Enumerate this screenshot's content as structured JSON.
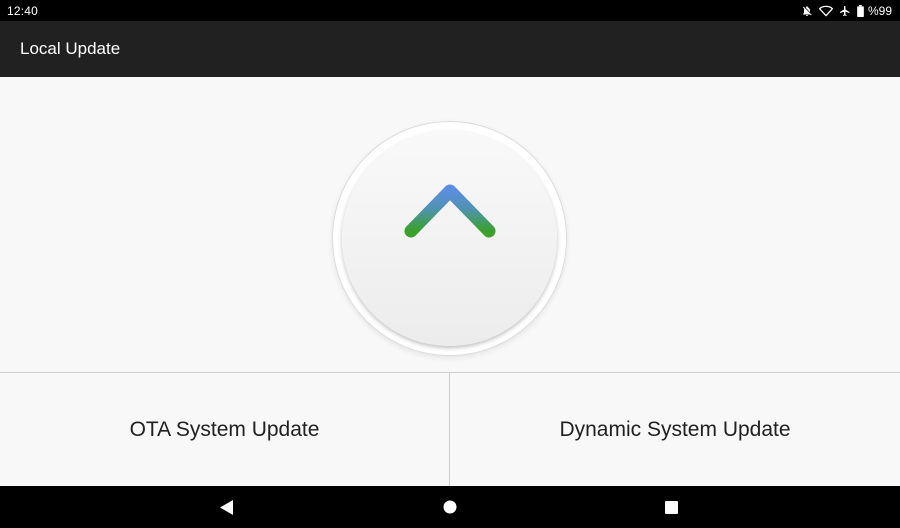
{
  "status_bar": {
    "time": "12:40",
    "battery_text": "%99",
    "icons": [
      "notifications-off-icon",
      "wifi-icon",
      "airplane-icon",
      "battery-icon"
    ]
  },
  "app_bar": {
    "title": "Local Update"
  },
  "main": {
    "upload_icon": "arrow-up-icon",
    "options": [
      {
        "label": "OTA System Update"
      },
      {
        "label": "Dynamic System Update"
      }
    ]
  },
  "nav_bar": {
    "icons": [
      "back-icon",
      "home-icon",
      "recents-icon"
    ]
  },
  "colors": {
    "status_bar": "#000000",
    "app_bar": "#212121",
    "background": "#f8f8f8",
    "arrow_top": "#5b8ee0",
    "arrow_bottom": "#3aa12a"
  }
}
